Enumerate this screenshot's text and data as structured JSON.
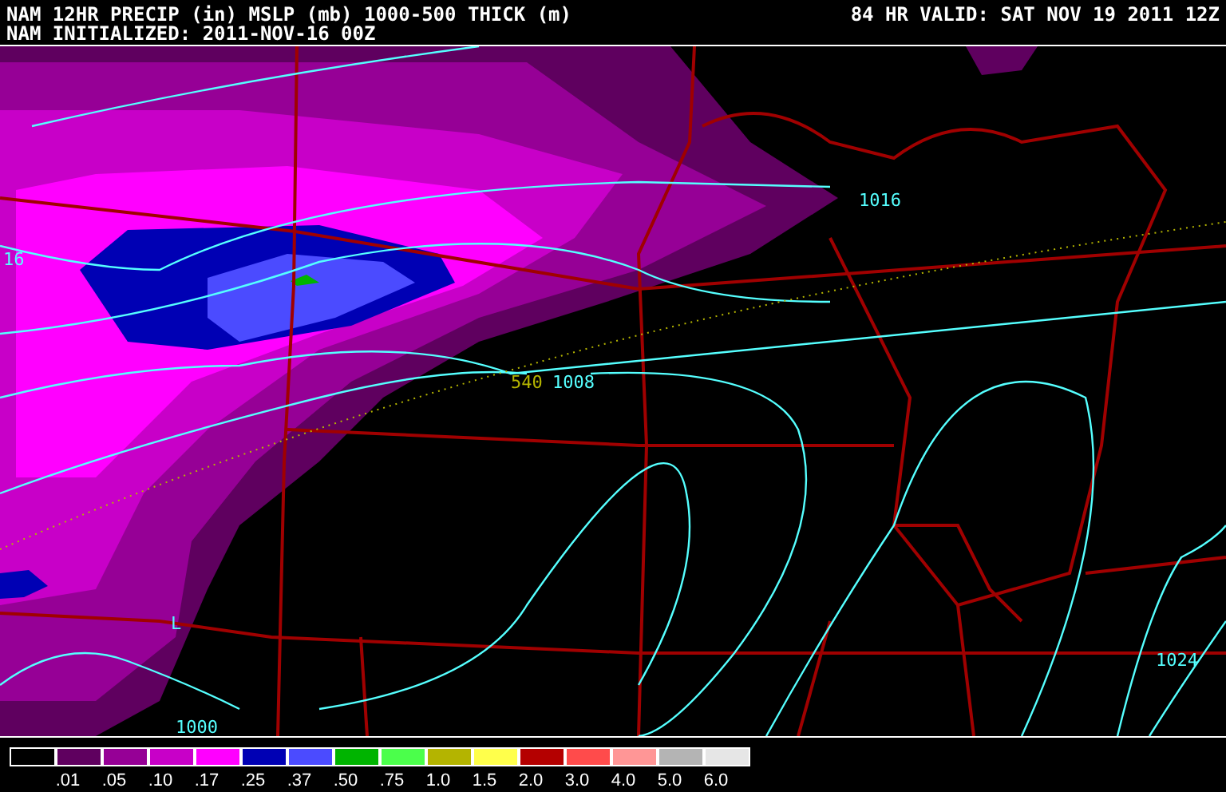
{
  "header": {
    "title": "NAM 12HR PRECIP (in) MSLP (mb) 1000-500 THICK (m)",
    "valid": "84 HR VALID: SAT NOV 19 2011 12Z",
    "initialized": "NAM INITIALIZED: 2011-NOV-16 00Z"
  },
  "map": {
    "labels": [
      {
        "text": "1016",
        "kind": "isobar"
      },
      {
        "text": "16",
        "kind": "isobar"
      },
      {
        "text": "540",
        "kind": "thickness"
      },
      {
        "text": "1008",
        "kind": "isobar"
      },
      {
        "text": "L",
        "kind": "low"
      },
      {
        "text": "1000",
        "kind": "isobar"
      },
      {
        "text": "1024",
        "kind": "isobar"
      }
    ]
  },
  "legend": {
    "colors": [
      {
        "color": "#000000"
      },
      {
        "color": "#5f005f"
      },
      {
        "color": "#960096"
      },
      {
        "color": "#c800c8"
      },
      {
        "color": "#ff00ff"
      },
      {
        "color": "#0000b4"
      },
      {
        "color": "#4b4bff"
      },
      {
        "color": "#00b400"
      },
      {
        "color": "#4bff4b"
      },
      {
        "color": "#b4b400"
      },
      {
        "color": "#ffff4b"
      },
      {
        "color": "#b40000"
      },
      {
        "color": "#ff4b4b"
      },
      {
        "color": "#ff9696"
      },
      {
        "color": "#b4b4b4"
      },
      {
        "color": "#e6e6e6"
      }
    ],
    "labels": [
      ".01",
      ".05",
      ".10",
      ".17",
      ".25",
      ".37",
      ".50",
      ".75",
      "1.0",
      "1.5",
      "2.0",
      "3.0",
      "4.0",
      "5.0",
      "6.0"
    ]
  }
}
